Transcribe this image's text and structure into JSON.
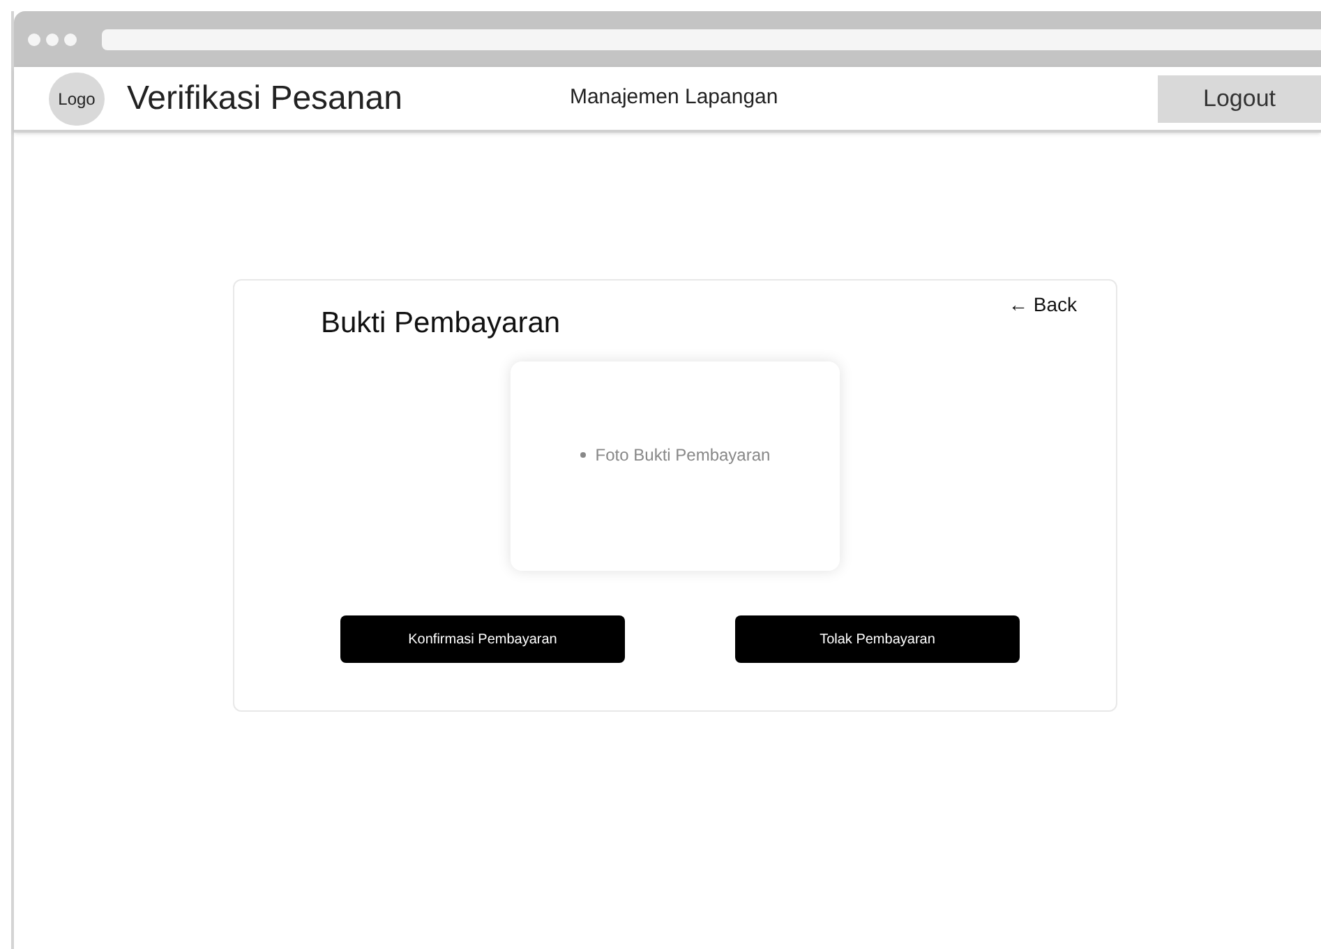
{
  "header": {
    "logo": "Logo",
    "title": "Verifikasi Pesanan",
    "nav_link": "Manajemen Lapangan",
    "logout": "Logout"
  },
  "card": {
    "title": "Bukti Pembayaran",
    "back": "← Back",
    "photo_placeholder": "Foto Bukti Pembayaran",
    "buttons": [
      "Konfirmasi Pembayaran",
      "Tolak Pembayaran"
    ]
  }
}
